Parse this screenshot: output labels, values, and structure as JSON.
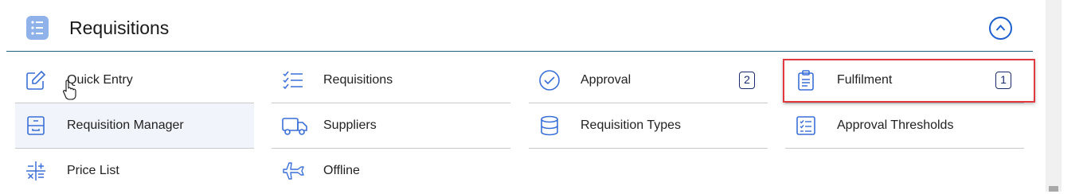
{
  "section": {
    "title": "Requisitions",
    "collapse_icon": "chevron-up-circle-icon"
  },
  "rows": [
    [
      {
        "label": "Quick Entry",
        "icon": "edit-icon"
      },
      {
        "label": "Requisitions",
        "icon": "checklist-icon"
      },
      {
        "label": "Approval",
        "icon": "check-circle-icon",
        "badge": "2"
      },
      {
        "label": "Fulfilment",
        "icon": "clipboard-icon",
        "badge": "1"
      }
    ],
    [
      {
        "label": "Requisition Manager",
        "icon": "cabinet-icon"
      },
      {
        "label": "Suppliers",
        "icon": "truck-icon"
      },
      {
        "label": "Requisition Types",
        "icon": "database-icon"
      },
      {
        "label": "Approval Thresholds",
        "icon": "list-icon"
      }
    ],
    [
      {
        "label": "Price List",
        "icon": "calculator-icon"
      },
      {
        "label": "Offline",
        "icon": "airplane-icon"
      }
    ]
  ],
  "colors": {
    "icon": "#3a6fd8",
    "badge_border": "#1a2a6c",
    "highlight": "#e0393f",
    "divider": "#1f5f7a"
  }
}
